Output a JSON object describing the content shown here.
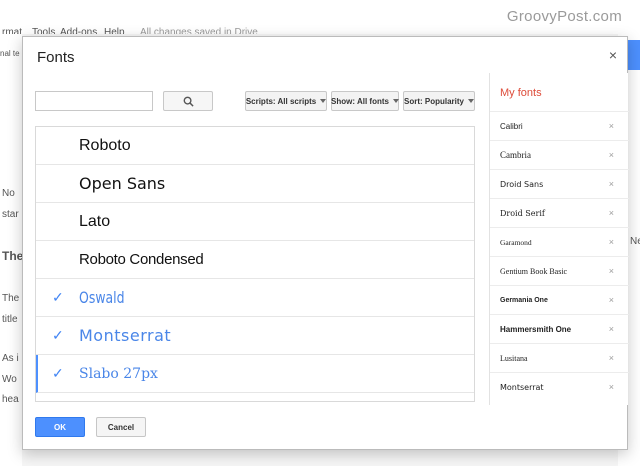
{
  "menu": {
    "format": "rmat",
    "tools": "Tools",
    "addons": "Add-ons",
    "help": "Help",
    "save_status": "All changes saved in Drive"
  },
  "watermark": "GroovyPost.com",
  "bg_text": {
    "left_1": "nal te",
    "left_2": "No",
    "left_3": "star",
    "left_4": "The",
    "left_5": "The",
    "left_6": "title",
    "left_7": "As i",
    "left_8": "Wo",
    "left_9": "hea",
    "right_1": "Ne"
  },
  "dialog": {
    "title": "Fonts",
    "close": "×",
    "search_placeholder": "",
    "filters": {
      "scripts": "Scripts: All scripts",
      "show": "Show: All fonts",
      "sort": "Sort: Popularity"
    },
    "fonts": [
      {
        "name": "Roboto",
        "selected": false
      },
      {
        "name": "Open Sans",
        "selected": false
      },
      {
        "name": "Lato",
        "selected": false
      },
      {
        "name": "Roboto Condensed",
        "selected": false
      },
      {
        "name": "Oswald",
        "selected": true
      },
      {
        "name": "Montserrat",
        "selected": true
      },
      {
        "name": "Slabo 27px",
        "selected": true
      }
    ],
    "check_mark": "✓",
    "my_fonts_title": "My fonts",
    "my_fonts": [
      "Calibri",
      "Cambria",
      "Droid Sans",
      "Droid Serif",
      "Garamond",
      "Gentium Book Basic",
      "Germania One",
      "Hammersmith One",
      "Lusitana",
      "Montserrat"
    ],
    "remove_mark": "×",
    "ok_label": "OK",
    "cancel_label": "Cancel"
  },
  "colors": {
    "accent_blue": "#4d90fe",
    "my_fonts_title": "#dd4b39",
    "selected_font": "#4a86e8"
  }
}
